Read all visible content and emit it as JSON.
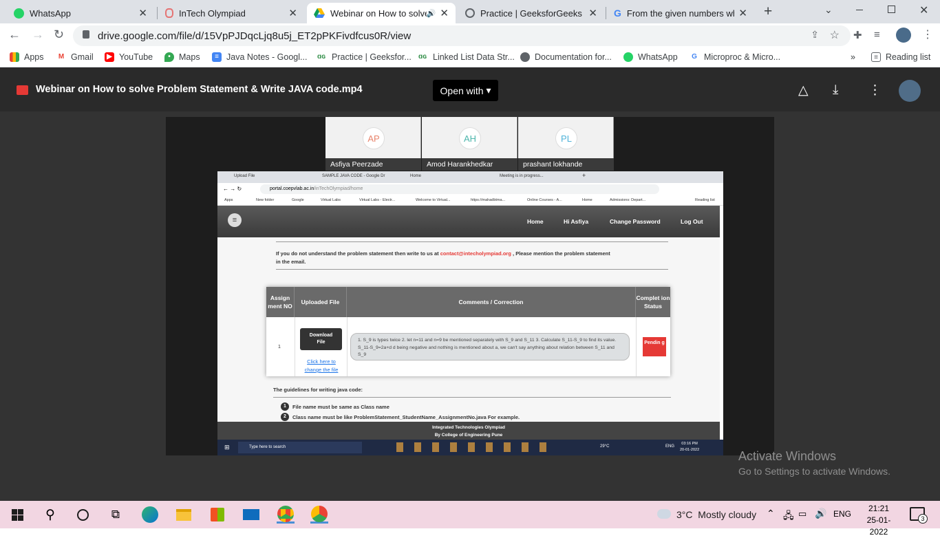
{
  "tabs": [
    {
      "title": "WhatsApp",
      "active": false
    },
    {
      "title": "InTech Olympiad",
      "active": false
    },
    {
      "title": "Webinar on How to solve",
      "active": true
    },
    {
      "title": "Practice | GeeksforGeeks | A",
      "active": false
    },
    {
      "title": "From the given numbers whi",
      "active": false
    }
  ],
  "address": {
    "url": "drive.google.com/file/d/15VpPJDqcLjq8u5j_ET2pPKFivdfcus0R/view"
  },
  "bookmarks": [
    {
      "label": "Apps"
    },
    {
      "label": "Gmail"
    },
    {
      "label": "YouTube"
    },
    {
      "label": "Maps"
    },
    {
      "label": "Java Notes - Googl..."
    },
    {
      "label": "Practice | Geeksfor..."
    },
    {
      "label": "Linked List Data Str..."
    },
    {
      "label": "Documentation for..."
    },
    {
      "label": "WhatsApp"
    },
    {
      "label": "Microproc & Micro..."
    }
  ],
  "reading_list": "Reading list",
  "viewer": {
    "title": "Webinar on How to solve Problem Statement & Write JAVA code.mp4",
    "open_with": "Open with"
  },
  "participants": [
    {
      "initials": "AP",
      "name": "Asfiya Peerzade",
      "color": "#e8836b"
    },
    {
      "initials": "AH",
      "name": "Amod Harankhedkar",
      "color": "#4db6ac"
    },
    {
      "initials": "PL",
      "name": "prashant lokhande",
      "color": "#4fb3d9"
    }
  ],
  "inner": {
    "tabs": [
      "Upload File",
      "SAMPLE JAVA CODE - Google Dr",
      "Home",
      "Meeting is in progress..."
    ],
    "url_host": "portal.coepvlab.ac.in",
    "url_path": "/inTechOlympiad/home",
    "bookmarks": [
      "Apps",
      "New folder",
      "Google",
      "Virtual Labs",
      "Virtual Labs - Electr...",
      "Welcome to Virtual...",
      "https://mahadbtma...",
      "Online Courses - A...",
      "Home",
      "Admissions: Depart..."
    ],
    "reading_list": "Reading list",
    "nav": {
      "home": "Home",
      "user": "Hi Asfiya",
      "password": "Change Password",
      "logout": "Log Out"
    },
    "notice_before": "If you do not understand the problem statement then write to us at ",
    "notice_email": "contact@intecholympiad.org",
    "notice_after": " , Please mention the problem statement",
    "notice_line2": "in the email.",
    "table": {
      "h_assign": "Assign ment NO",
      "h_upload": "Uploaded File",
      "h_comments": "Comments / Correction",
      "h_status": "Complet ion Status",
      "row_no": "1",
      "download": "Download File",
      "change_link": "Click here to change the file",
      "comment": "1. S_9 is types twice 2. let n=11 and n=9 be mentioned separately with S_9 and S_11 3. Calculate S_11-S_9 to find its value. S_11-S_9=2a+d d being negative and nothing is mentioned about a, we can't say anything about relation between S_11 and S_9",
      "status": "Pendin g"
    },
    "guidelines_title": "The guidelines for writing java code:",
    "guidelines": [
      "File name must be same as Class name",
      "Class name must be like ProblemStatement_StudentName_AssignmentNo.java For example."
    ],
    "footer1": "Integrated Technologies Olympiad",
    "footer2": "By College of Engineering Pune",
    "taskbar": {
      "search": "Type here to search",
      "weather": "29°C",
      "lang": "ENG",
      "time": "03:16 PM",
      "date": "20-01-2022"
    }
  },
  "activate": {
    "line1": "Activate Windows",
    "line2": "Go to Settings to activate Windows."
  },
  "taskbar": {
    "weather_temp": "3°C",
    "weather_text": "Mostly cloudy",
    "lang": "ENG",
    "time": "21:21",
    "date": "25-01-2022",
    "notif_count": "3"
  }
}
